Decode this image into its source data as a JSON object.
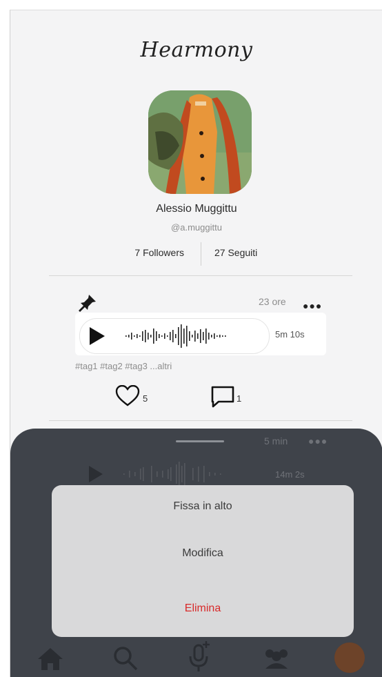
{
  "app": {
    "brand": "Hearmony"
  },
  "profile": {
    "name": "Alessio Muggittu",
    "handle": "@a.muggittu",
    "followers": "7 Followers",
    "following": "27 Seguiti"
  },
  "post": {
    "time": "23 ore",
    "duration": "5m 10s",
    "tags": "#tag1 #tag2 #tag3 ...altri",
    "likes": "5",
    "comments": "1"
  },
  "background_post": {
    "time": "5 min",
    "duration": "14m 2s"
  },
  "menu": {
    "pin_label": "Fissa in alto",
    "edit_label": "Modifica",
    "delete_label": "Elimina"
  },
  "nav": {
    "items": [
      "home-icon",
      "search-icon",
      "microphone-add-icon",
      "people-icon",
      "profile-avatar"
    ]
  },
  "colors": {
    "sheet": "#3f434a",
    "menu": "#d9d9da",
    "danger": "#d82a2a",
    "background": "#f4f4f5"
  }
}
